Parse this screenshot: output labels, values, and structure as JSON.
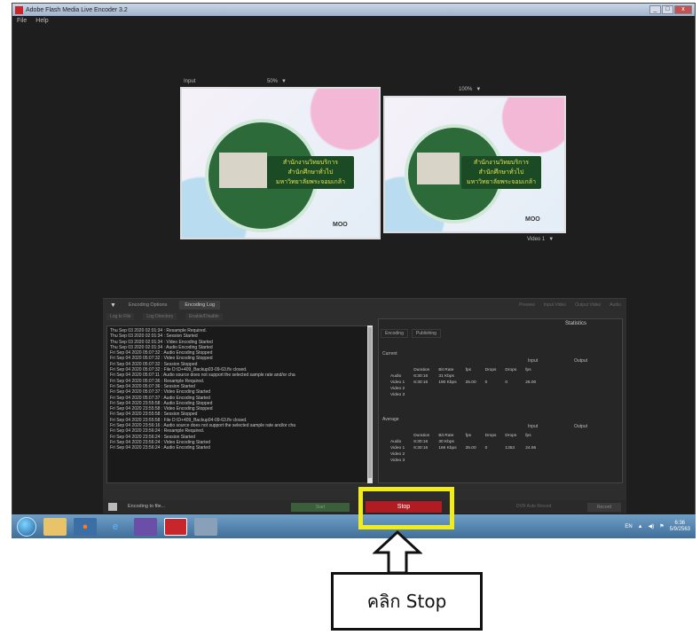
{
  "window": {
    "title": "Adobe Flash Media Live Encoder 3.2",
    "controls": [
      "_",
      "□",
      "x"
    ]
  },
  "menu": [
    "File",
    "Help"
  ],
  "preview": {
    "input_label": "Input",
    "input_zoom": "50%",
    "output_zoom": "100%",
    "output_source": "Video 1",
    "slide_title_line1": "สำนักงานวิทยบริการ",
    "slide_title_line2": "สำนักศึกษาทั่วไป",
    "slide_title_line3": "มหาวิทยาลัยพระจอมเกล้า",
    "slide_logo": "MOO"
  },
  "panel": {
    "tabs": [
      "Encoding Options",
      "Encoding Log"
    ],
    "right_items": [
      "Preview",
      "Input Video",
      "Output Video",
      "Audio"
    ],
    "log_toolbar": [
      "Log to File",
      "Log Directory",
      "Enable/Disable"
    ],
    "log_lines": [
      "Thu Sep 03 2020 02:01:34 : Resample Required.",
      "Thu Sep 03 2020 02:01:34 : Session Started",
      "Thu Sep 03 2020 02:01:34 : Video Encoding Started",
      "Thu Sep 03 2020 02:01:34 : Audio Encoding Started",
      "Fri Sep 04 2020 05:07:32 : Audio Encoding Stopped",
      "Fri Sep 04 2020 05:07:32 : Video Encoding Stopped",
      "Fri Sep 04 2020 05:07:32 : Session Stopped",
      "Fri Sep 04 2020 05:07:32 : File D:\\D+409_Backup03-09-63.flv closed.",
      "Fri Sep 04 2020 05:07:11 : Audio source does not support the selected sample rate and/or cha",
      "Fri Sep 04 2020 05:07:36 : Resample Required.",
      "Fri Sep 04 2020 05:07:36 : Session Started",
      "Fri Sep 04 2020 05:07:37 : Video Encoding Started",
      "Fri Sep 04 2020 05:07:37 : Audio Encoding Started",
      "Fri Sep 04 2020 23:55:58 : Audio Encoding Stopped",
      "Fri Sep 04 2020 23:55:58 : Video Encoding Stopped",
      "Fri Sep 04 2020 23:55:58 : Session Stopped",
      "Fri Sep 04 2020 23:55:58 : File D:\\D+409_Backup04-09-63.flv closed.",
      "Fri Sep 04 2020 23:56:16 : Audio source does not support the selected sample rate and/or cha",
      "Fri Sep 04 2020 23:56:24 : Resample Required.",
      "Fri Sep 04 2020 23:56:24 : Session Started",
      "Fri Sep 04 2020 23:56:24 : Video Encoding Started",
      "Fri Sep 04 2020 23:56:24 : Audio Encoding Started"
    ],
    "stats": {
      "header": "Statistics",
      "tabs": [
        "Encoding",
        "Publishing"
      ],
      "current_label": "Current",
      "average_label": "Average",
      "group_input": "Input",
      "group_output": "Output",
      "columns": [
        "",
        "Duration",
        "Bit Rate",
        "fps",
        "Drops",
        "Drops",
        "fps"
      ],
      "current_rows": [
        [
          "Audio",
          "6:30:16",
          "31 Kbps",
          "",
          "",
          "",
          ""
        ],
        [
          "Video 1",
          "6:30:16",
          "190 Kbps",
          "25.00",
          "0",
          "0",
          "26.00"
        ],
        [
          "Video 2",
          "",
          "",
          "",
          "",
          "",
          ""
        ],
        [
          "Video 3",
          "",
          "",
          "",
          "",
          "",
          ""
        ]
      ],
      "average_rows": [
        [
          "Audio",
          "6:30:16",
          "30 Kbps",
          "",
          "",
          "",
          ""
        ],
        [
          "Video 1",
          "6:30:16",
          "166 Kbps",
          "25.00",
          "0",
          "1353",
          "24.95"
        ],
        [
          "Video 2",
          "",
          "",
          "",
          "",
          "",
          ""
        ],
        [
          "Video 3",
          "",
          "",
          "",
          "",
          "",
          ""
        ]
      ]
    }
  },
  "statusbar": {
    "status": "Encoding to file...",
    "start_label": "Start",
    "stop_label": "Stop",
    "dvr_label": "DVR Auto Record",
    "record_label": "Record"
  },
  "taskbar": {
    "tray_lang": "EN",
    "time": "6:36",
    "date": "5/9/2563"
  },
  "annotation": {
    "callout": "คลิก Stop",
    "highlight_color": "#f2ec1b"
  }
}
